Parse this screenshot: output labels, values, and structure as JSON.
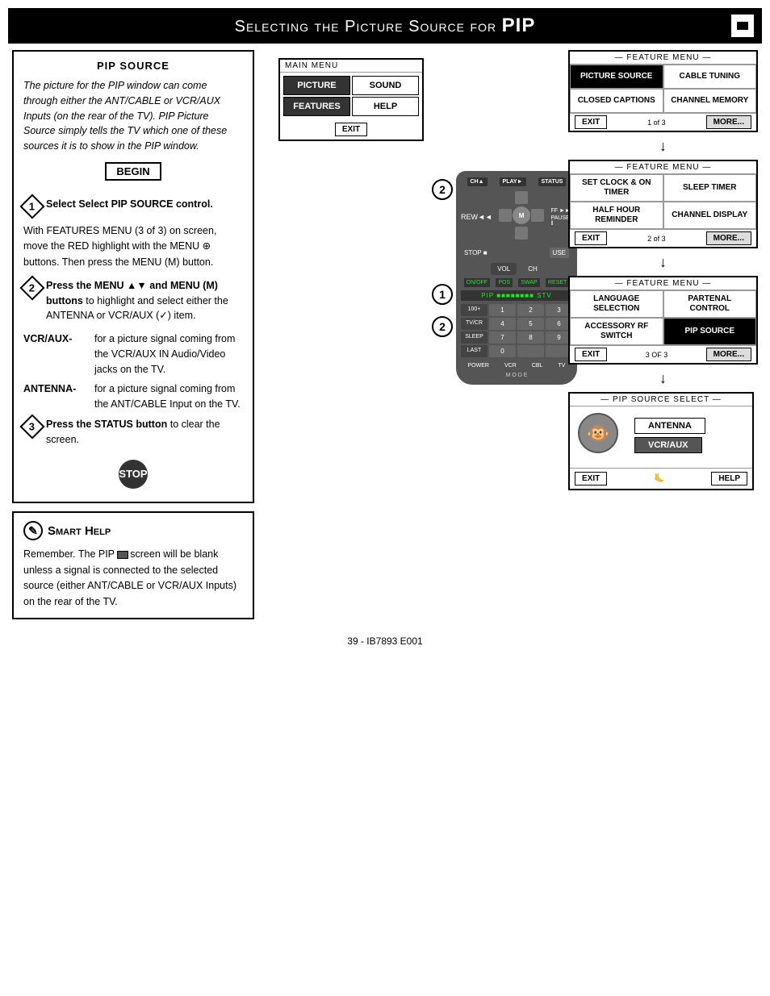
{
  "page": {
    "footer": "39 - IB7893 E001"
  },
  "title": {
    "prefix": "Selecting the Picture Source for ",
    "highlight": "PIP"
  },
  "pip_source": {
    "heading": "PIP SOURCE",
    "intro": "The picture for the PIP window can come through either the ANT/CABLE or VCR/AUX Inputs (on the rear of the TV). PIP Picture Source simply tells the TV which one of these sources it is to show in the PIP window.",
    "begin_label": "BEGIN",
    "step1_label": "1",
    "step1_text": "Select PIP SOURCE control.",
    "step1_detail": "With FEATURES MENU (3 of 3) on screen, move the RED highlight with the MENU",
    "step1_detail2": "buttons. Then press the MENU (M) button.",
    "step2_label": "2",
    "step2_heading": "Press the MENU ▲▼ and MENU (M) buttons",
    "step2_text": " to highlight and select either the ANTENNA or VCR/AUX (✓) item.",
    "vcr_label": "VCR/AUX-",
    "vcr_desc": "for a picture signal coming from the VCR/AUX IN Audio/Video jacks on the TV.",
    "antenna_label": "ANTENNA-",
    "antenna_desc": "for a picture signal coming from the ANT/CABLE Input on the TV.",
    "step3_label": "3",
    "step3_text": "Press the STATUS button to clear the screen.",
    "stop_label": "STOP"
  },
  "smart_help": {
    "title": "Smart Help",
    "text": "Remember. The PIP screen will be blank unless a signal is connected to the selected source (either ANT/CABLE or VCR/AUX Inputs) on the rear of the TV."
  },
  "menus": {
    "feature_menu_label": "FEATURE MENU",
    "main_menu_label": "MAIN MENU",
    "menu1": {
      "page": "1 of 3",
      "buttons": [
        "PICTURE SOURCE",
        "CABLE TUNING",
        "CLOSED CAPTIONS",
        "CHANNEL MEMORY"
      ],
      "exit": "EXIT",
      "more": "MORE..."
    },
    "menu2": {
      "page": "2 of 3",
      "buttons": [
        "SET CLOCK & ON TIMER",
        "SLEEP TIMER",
        "HALF HOUR REMINDER",
        "CHANNEL DISPLAY"
      ],
      "exit": "EXIT",
      "more": "MORE..."
    },
    "menu3": {
      "page": "3 of 3",
      "buttons": [
        "LANGUAGE SELECTION",
        "PARTENAL CONTROL",
        "ACCESSORY RF SWITCH",
        "PIP SOURCE"
      ],
      "exit": "EXIT",
      "more": "MORE..."
    },
    "pip_source_select": {
      "title": "PIP SOURCE SELECT",
      "options": [
        "ANTENNA",
        "VCR/AUX"
      ],
      "exit": "EXIT",
      "help": "HELP"
    },
    "main_menu_buttons": [
      "PICTURE",
      "SOUND",
      "FEATURES",
      "HELP"
    ],
    "exit": "EXIT"
  }
}
